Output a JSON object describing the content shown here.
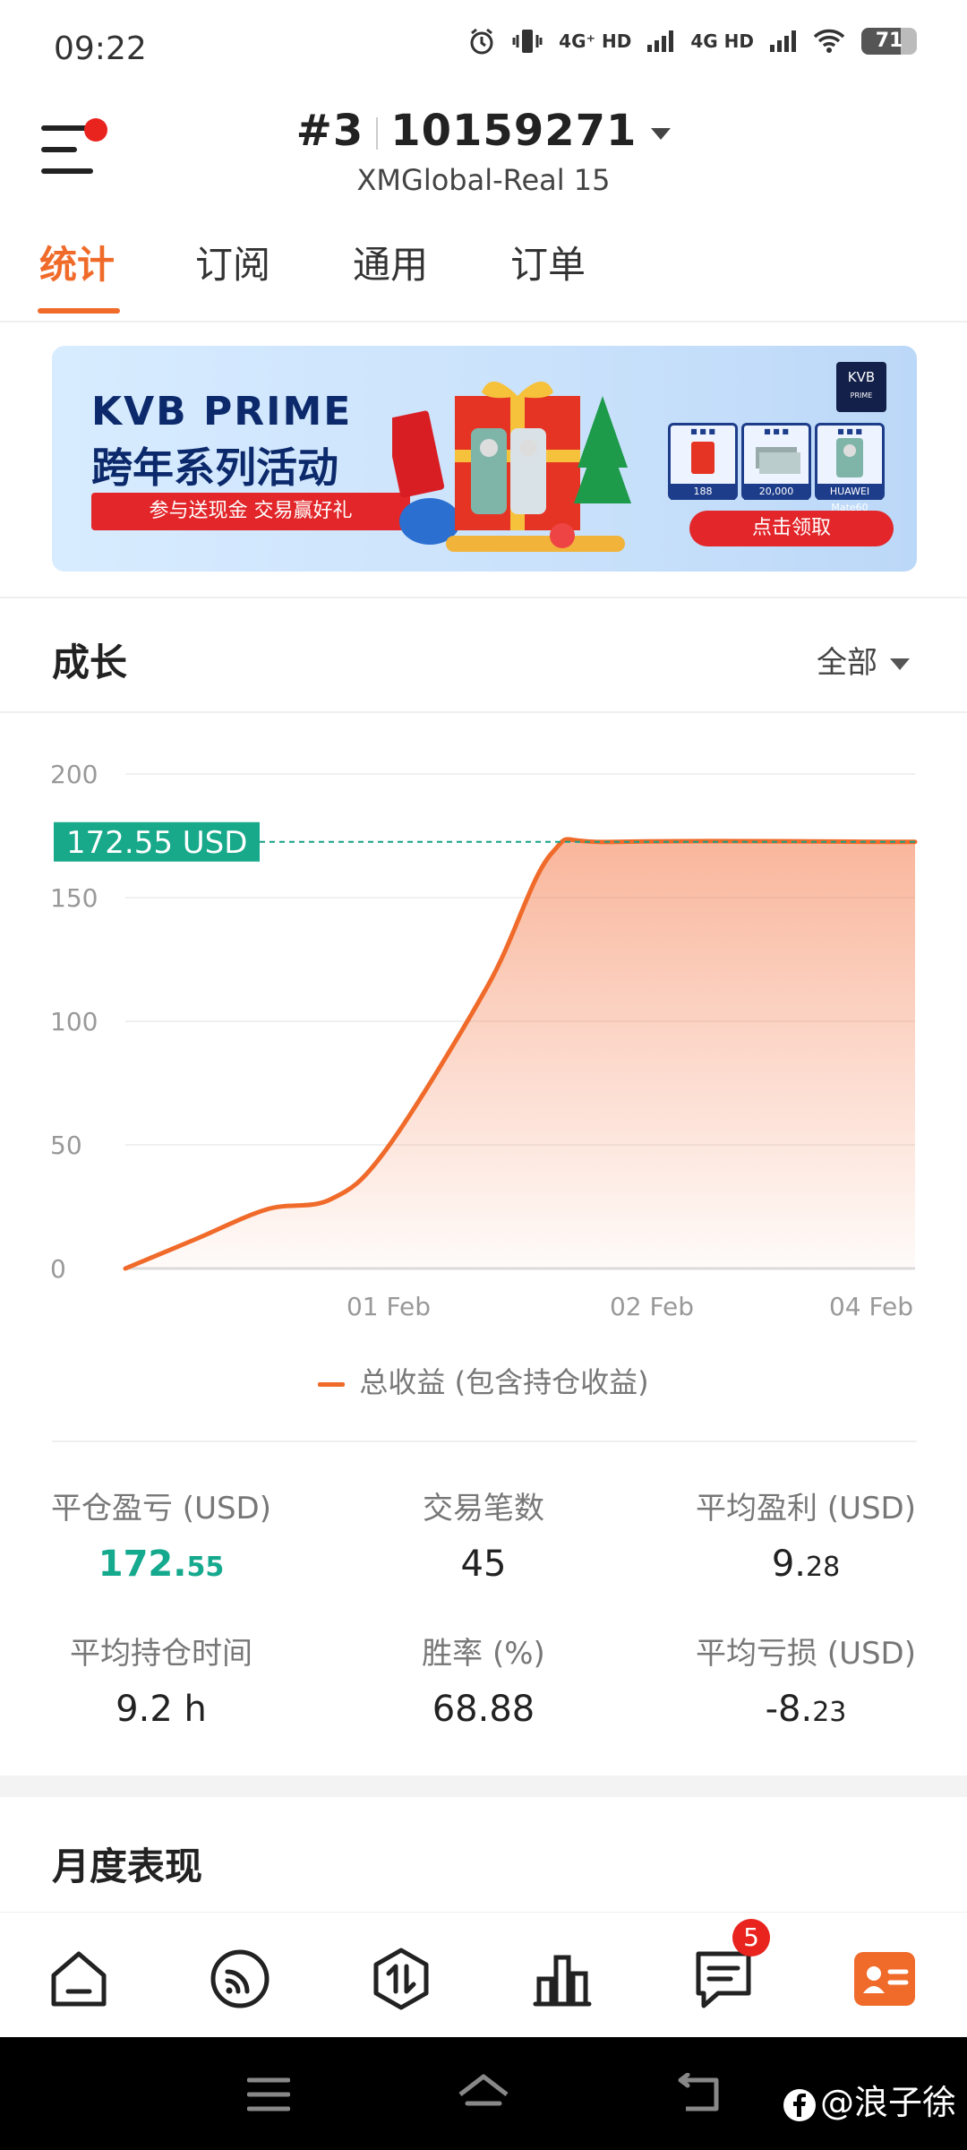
{
  "status_bar": {
    "time": "09:22",
    "net1": "4G⁺ HD",
    "net2": "4G HD",
    "battery": "71",
    "battery_level": 0.71
  },
  "header": {
    "account_prefix": "#3",
    "account_number": "10159271",
    "server": "XMGlobal-Real 15"
  },
  "tabs": [
    "统计",
    "订阅",
    "通用",
    "订单"
  ],
  "active_tab": 0,
  "banner": {
    "brand": "KVB PRIME",
    "title": "跨年系列活动",
    "ribbon": "参与送现金 交易赢好礼",
    "logo": "KVB",
    "logo_sub": "PRIME",
    "prizes": [
      {
        "label": "188"
      },
      {
        "label": "20,000"
      },
      {
        "label": "HUAWEI Mate60"
      }
    ],
    "cta": "点击领取"
  },
  "growth": {
    "title": "成长",
    "filter": "全部"
  },
  "chart_data": {
    "type": "area",
    "y_ticks": [
      "200",
      "150",
      "100",
      "50",
      "0"
    ],
    "x_ticks": [
      "01 Feb",
      "02 Feb",
      "04 Feb"
    ],
    "ylim": [
      0,
      200
    ],
    "current_value_label": "172.55 USD",
    "current_value": 172.55,
    "series": [
      {
        "name": "总收益 (包含持仓收益)",
        "color": "#f06a2a",
        "points": [
          {
            "x": "31 Jan",
            "y": 0
          },
          {
            "x": "31 Jan",
            "y": 12
          },
          {
            "x": "31 Jan",
            "y": 24
          },
          {
            "x": "01 Feb",
            "y": 28
          },
          {
            "x": "01 Feb",
            "y": 48
          },
          {
            "x": "02 Feb",
            "y": 115
          },
          {
            "x": "02 Feb",
            "y": 168
          },
          {
            "x": "02 Feb",
            "y": 172.55
          },
          {
            "x": "04 Feb",
            "y": 172.55
          }
        ]
      }
    ],
    "grid": true
  },
  "stats": [
    {
      "label": "平仓盈亏 (USD)",
      "int": "172.",
      "dec": "55",
      "highlight": true
    },
    {
      "label": "交易笔数",
      "int": "45",
      "dec": "",
      "highlight": false
    },
    {
      "label": "平均盈利 (USD)",
      "int": "9.",
      "dec": "28",
      "highlight": false
    },
    {
      "label": "平均持仓时间",
      "int": "9.2 h",
      "dec": "",
      "highlight": false
    },
    {
      "label": "胜率 (%)",
      "int": "68.88",
      "dec": "",
      "highlight": false
    },
    {
      "label": "平均亏损 (USD)",
      "int": "-8.",
      "dec": "23",
      "highlight": false
    }
  ],
  "monthly_title": "月度表现",
  "bottom_nav": {
    "items": [
      "home-icon",
      "signal-icon",
      "trade-icon",
      "chart-icon",
      "messages-icon",
      "profile-icon"
    ],
    "active": 5,
    "badge": "5"
  },
  "watermark": "@浪子徐",
  "colors": {
    "accent": "#f06a2a",
    "green": "#15a98e",
    "badge": "#e9231e"
  }
}
